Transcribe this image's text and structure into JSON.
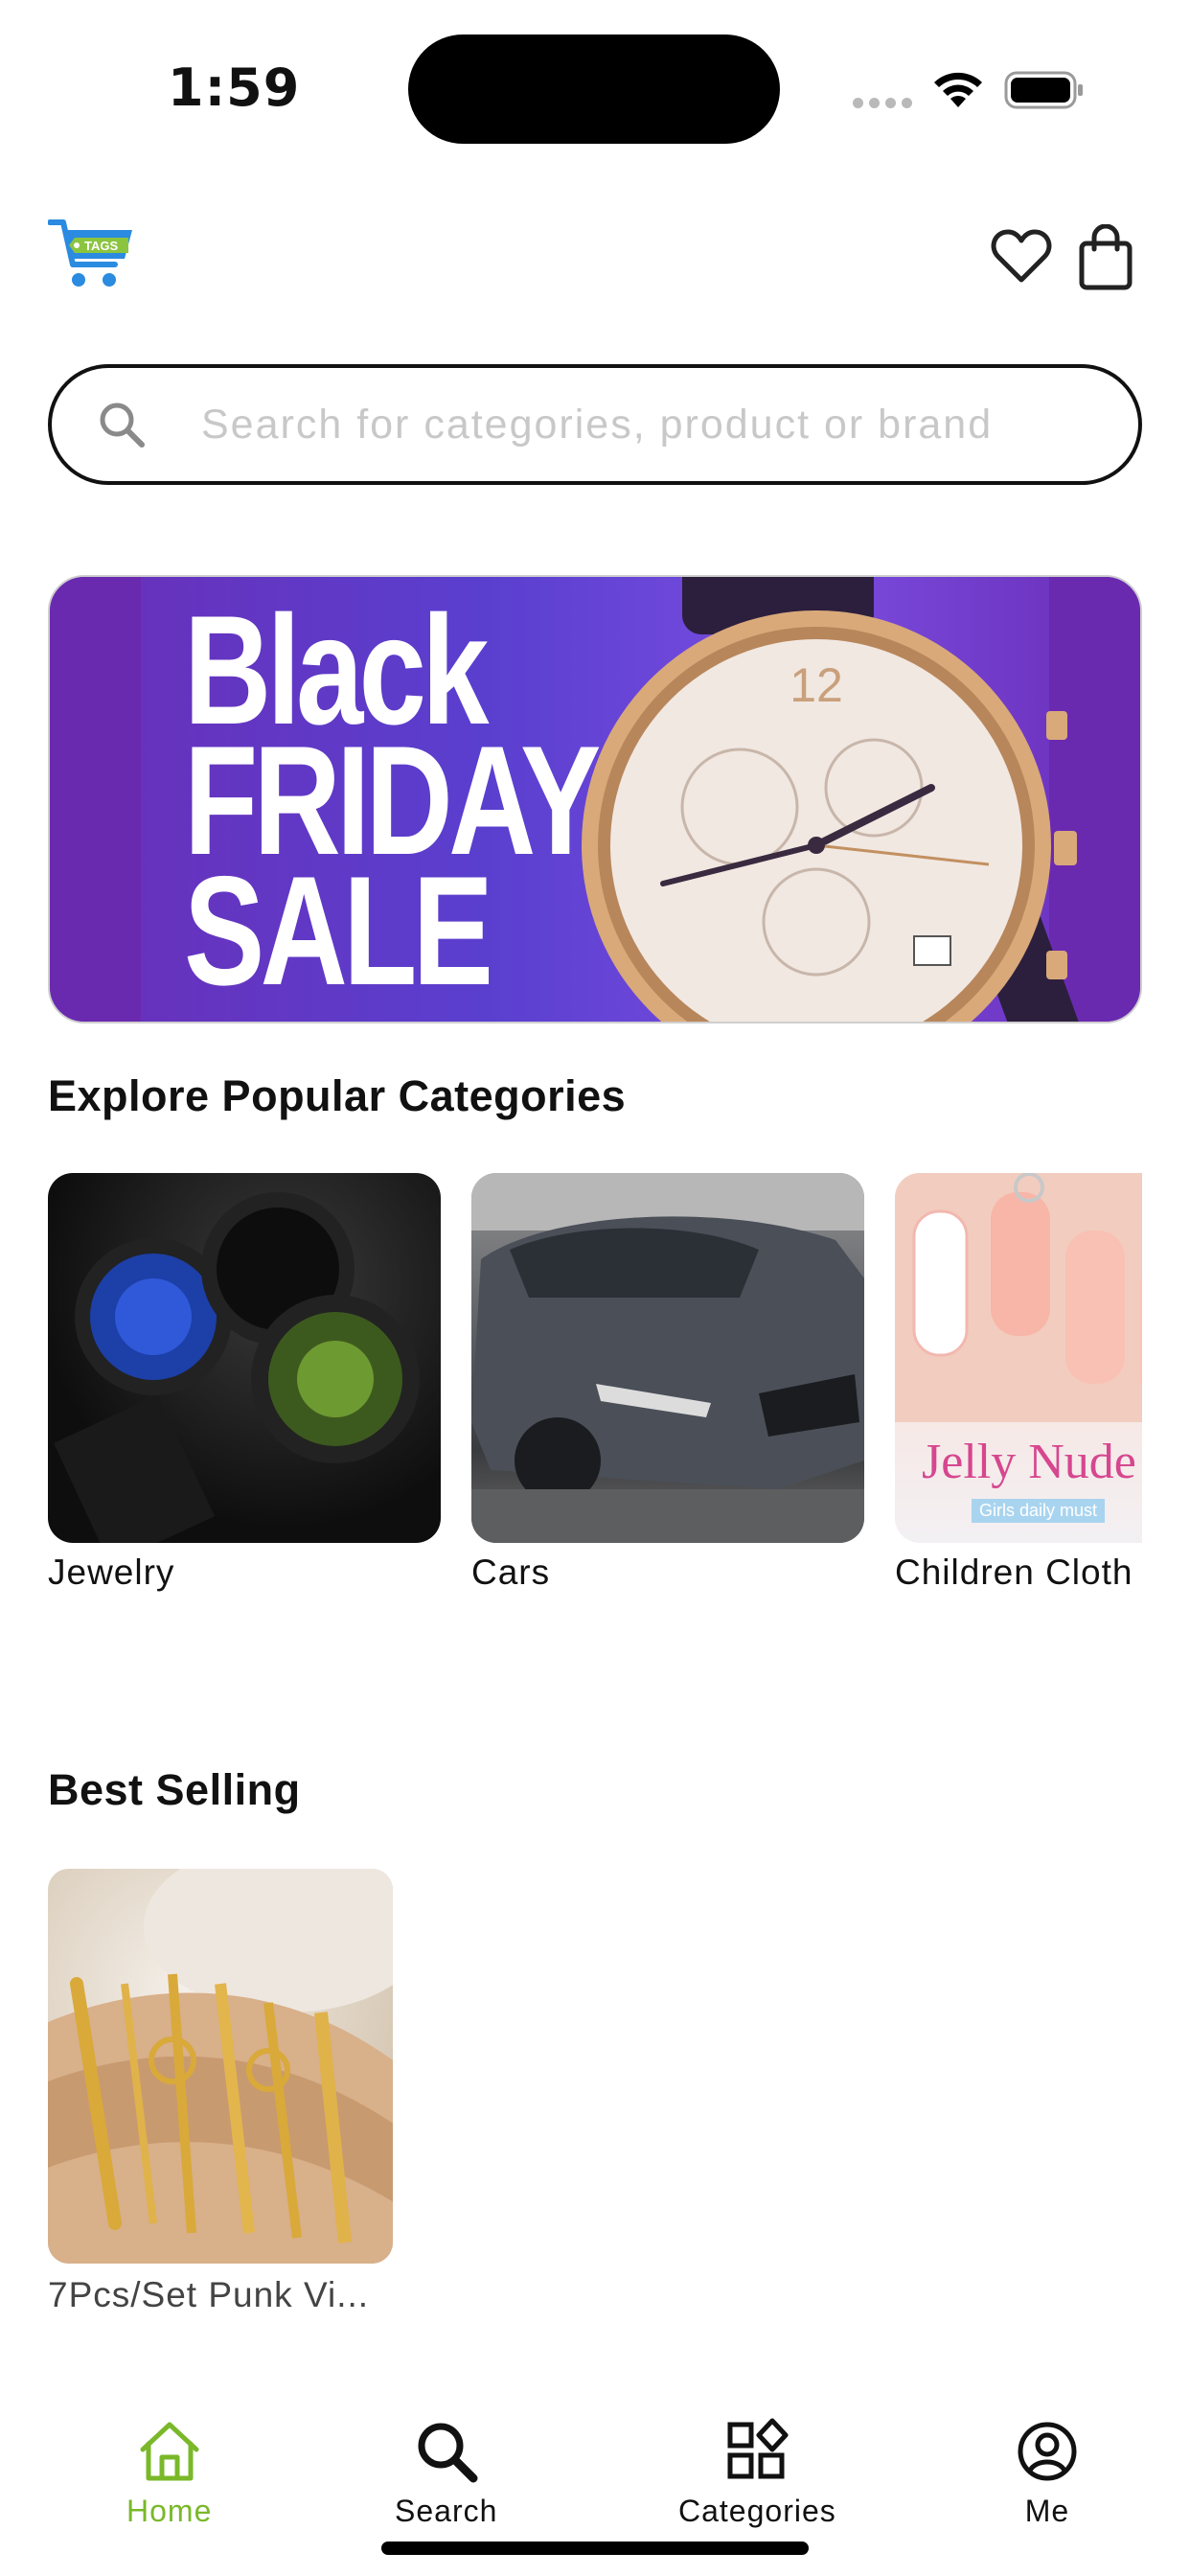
{
  "status_bar": {
    "time": "1:59"
  },
  "header": {
    "logo_icon": "cart-tags-logo",
    "logo_text": "TAGS",
    "wishlist_icon": "heart-icon",
    "bag_icon": "shopping-bag-icon"
  },
  "search": {
    "placeholder": "Search for categories, product or brand",
    "value": ""
  },
  "banner": {
    "line1": "Black",
    "line2": "FRIDAY",
    "line3": "SALE"
  },
  "categories": {
    "title": "Explore Popular Categories",
    "items": [
      {
        "label": "Jewelry"
      },
      {
        "label": "Cars"
      },
      {
        "label": "Children Cloth"
      }
    ],
    "nail_image_text": "Jelly Nude",
    "nail_image_subtext": "Girls daily must"
  },
  "best_selling": {
    "title": "Best Selling",
    "products": [
      {
        "title": "7Pcs/Set Punk Vi..."
      }
    ]
  },
  "tabbar": {
    "items": [
      {
        "label": "Home",
        "icon": "home-icon",
        "active": true
      },
      {
        "label": "Search",
        "icon": "search-icon",
        "active": false
      },
      {
        "label": "Categories",
        "icon": "categories-icon",
        "active": false
      },
      {
        "label": "Me",
        "icon": "user-circle-icon",
        "active": false
      }
    ]
  },
  "colors": {
    "accent_green": "#7ab82a",
    "logo_blue": "#2b8be0",
    "banner_purple": "#6a2fb8"
  }
}
